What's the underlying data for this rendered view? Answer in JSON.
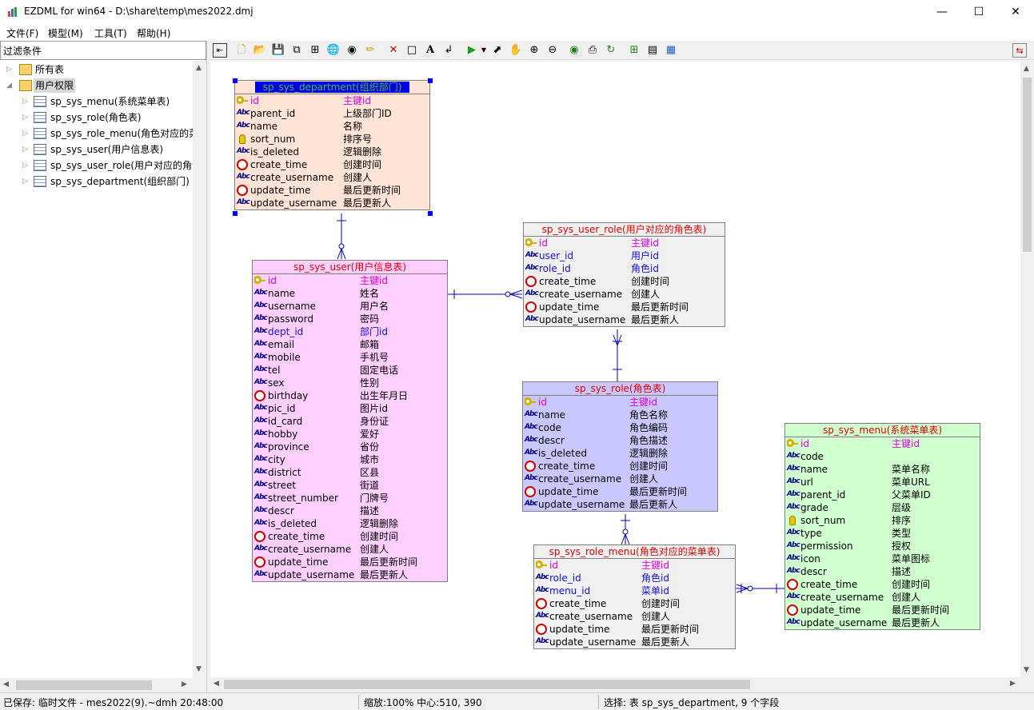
{
  "window": {
    "title": "EZDML for win64 - D:\\share\\temp\\mes2022.dmj"
  },
  "menu": [
    "文件(F)",
    "模型(M)",
    "工具(T)",
    "帮助(H)"
  ],
  "filter": {
    "label": "过滤条件"
  },
  "tree": {
    "root_all": "所有表",
    "group": "用户权限",
    "items": [
      "sp_sys_menu(系统菜单表)",
      "sp_sys_role(角色表)",
      "sp_sys_role_menu(角色对应的菜",
      "sp_sys_user(用户信息表)",
      "sp_sys_user_role(用户对应的角色",
      "sp_sys_department(组织部门)"
    ]
  },
  "entities": {
    "department": {
      "title": "sp_sys_department(组织部门)",
      "bg": "#fde4d6",
      "fields": [
        {
          "n": "id",
          "c": "主键id",
          "i": "key",
          "k": "pk"
        },
        {
          "n": "parent_id",
          "c": "上级部门ID",
          "i": "abc",
          "k": ""
        },
        {
          "n": "name",
          "c": "名称",
          "i": "abc",
          "k": ""
        },
        {
          "n": "sort_num",
          "c": "排序号",
          "i": "bulb",
          "k": ""
        },
        {
          "n": "is_deleted",
          "c": "逻辑删除",
          "i": "abc",
          "k": ""
        },
        {
          "n": "create_time",
          "c": "创建时间",
          "i": "clock",
          "k": ""
        },
        {
          "n": "create_username",
          "c": "创建人",
          "i": "abc",
          "k": ""
        },
        {
          "n": "update_time",
          "c": "最后更新时间",
          "i": "clock",
          "k": ""
        },
        {
          "n": "update_username",
          "c": "最后更新人",
          "i": "abc",
          "k": ""
        }
      ]
    },
    "user": {
      "title": "sp_sys_user(用户信息表)",
      "bg": "#ffd0ff",
      "fields": [
        {
          "n": "id",
          "c": "主键id",
          "i": "key",
          "k": "pk"
        },
        {
          "n": "name",
          "c": "姓名",
          "i": "abc",
          "k": ""
        },
        {
          "n": "username",
          "c": "用户名",
          "i": "abc",
          "k": ""
        },
        {
          "n": "password",
          "c": "密码",
          "i": "abc",
          "k": ""
        },
        {
          "n": "dept_id",
          "c": "部门id",
          "i": "abc",
          "k": "fk"
        },
        {
          "n": "email",
          "c": "邮箱",
          "i": "abc",
          "k": ""
        },
        {
          "n": "mobile",
          "c": "手机号",
          "i": "abc",
          "k": ""
        },
        {
          "n": "tel",
          "c": "固定电话",
          "i": "abc",
          "k": ""
        },
        {
          "n": "sex",
          "c": "性别",
          "i": "abc",
          "k": ""
        },
        {
          "n": "birthday",
          "c": "出生年月日",
          "i": "clock",
          "k": ""
        },
        {
          "n": "pic_id",
          "c": "图片id",
          "i": "abc",
          "k": ""
        },
        {
          "n": "id_card",
          "c": "身份证",
          "i": "abc",
          "k": ""
        },
        {
          "n": "hobby",
          "c": "爱好",
          "i": "abc",
          "k": ""
        },
        {
          "n": "province",
          "c": "省份",
          "i": "abc",
          "k": ""
        },
        {
          "n": "city",
          "c": "城市",
          "i": "abc",
          "k": ""
        },
        {
          "n": "district",
          "c": "区县",
          "i": "abc",
          "k": ""
        },
        {
          "n": "street",
          "c": "街道",
          "i": "abc",
          "k": ""
        },
        {
          "n": "street_number",
          "c": "门牌号",
          "i": "abc",
          "k": ""
        },
        {
          "n": "descr",
          "c": "描述",
          "i": "abc",
          "k": ""
        },
        {
          "n": "is_deleted",
          "c": "逻辑删除",
          "i": "abc",
          "k": ""
        },
        {
          "n": "create_time",
          "c": "创建时间",
          "i": "clock",
          "k": ""
        },
        {
          "n": "create_username",
          "c": "创建人",
          "i": "abc",
          "k": ""
        },
        {
          "n": "update_time",
          "c": "最后更新时间",
          "i": "clock",
          "k": ""
        },
        {
          "n": "update_username",
          "c": "最后更新人",
          "i": "abc",
          "k": ""
        }
      ]
    },
    "user_role": {
      "title": "sp_sys_user_role(用户对应的角色表)",
      "bg": "#f0f0f0",
      "fields": [
        {
          "n": "id",
          "c": "主键id",
          "i": "key",
          "k": "pk"
        },
        {
          "n": "user_id",
          "c": "用户id",
          "i": "abc",
          "k": "fk"
        },
        {
          "n": "role_id",
          "c": "角色id",
          "i": "abc",
          "k": "fk"
        },
        {
          "n": "create_time",
          "c": "创建时间",
          "i": "clock",
          "k": ""
        },
        {
          "n": "create_username",
          "c": "创建人",
          "i": "abc",
          "k": ""
        },
        {
          "n": "update_time",
          "c": "最后更新时间",
          "i": "clock",
          "k": ""
        },
        {
          "n": "update_username",
          "c": "最后更新人",
          "i": "abc",
          "k": ""
        }
      ]
    },
    "role": {
      "title": "sp_sys_role(角色表)",
      "bg": "#c8c8ff",
      "fields": [
        {
          "n": "id",
          "c": "主键id",
          "i": "key",
          "k": "pk"
        },
        {
          "n": "name",
          "c": "角色名称",
          "i": "abc",
          "k": ""
        },
        {
          "n": "code",
          "c": "角色编码",
          "i": "abc",
          "k": ""
        },
        {
          "n": "descr",
          "c": "角色描述",
          "i": "abc",
          "k": ""
        },
        {
          "n": "is_deleted",
          "c": "逻辑删除",
          "i": "abc",
          "k": ""
        },
        {
          "n": "create_time",
          "c": "创建时间",
          "i": "clock",
          "k": ""
        },
        {
          "n": "create_username",
          "c": "创建人",
          "i": "abc",
          "k": ""
        },
        {
          "n": "update_time",
          "c": "最后更新时间",
          "i": "clock",
          "k": ""
        },
        {
          "n": "update_username",
          "c": "最后更新人",
          "i": "abc",
          "k": ""
        }
      ]
    },
    "role_menu": {
      "title": "sp_sys_role_menu(角色对应的菜单表)",
      "bg": "#f0f0f0",
      "fields": [
        {
          "n": "id",
          "c": "主键id",
          "i": "key",
          "k": "pk"
        },
        {
          "n": "role_id",
          "c": "角色id",
          "i": "abc",
          "k": "fk"
        },
        {
          "n": "menu_id",
          "c": "菜单id",
          "i": "abc",
          "k": "fk"
        },
        {
          "n": "create_time",
          "c": "创建时间",
          "i": "clock",
          "k": ""
        },
        {
          "n": "create_username",
          "c": "创建人",
          "i": "abc",
          "k": ""
        },
        {
          "n": "update_time",
          "c": "最后更新时间",
          "i": "clock",
          "k": ""
        },
        {
          "n": "update_username",
          "c": "最后更新人",
          "i": "abc",
          "k": ""
        }
      ]
    },
    "menu": {
      "title": "sp_sys_menu(系统菜单表)",
      "bg": "#d0ffd0",
      "fields": [
        {
          "n": "id",
          "c": "主键id",
          "i": "key",
          "k": "pk"
        },
        {
          "n": "code",
          "c": "",
          "i": "abc",
          "k": ""
        },
        {
          "n": "name",
          "c": "菜单名称",
          "i": "abc",
          "k": ""
        },
        {
          "n": "url",
          "c": "菜单URL",
          "i": "abc",
          "k": ""
        },
        {
          "n": "parent_id",
          "c": "父菜单ID",
          "i": "abc",
          "k": ""
        },
        {
          "n": "grade",
          "c": "层级",
          "i": "abc",
          "k": ""
        },
        {
          "n": "sort_num",
          "c": "排序",
          "i": "bulb",
          "k": ""
        },
        {
          "n": "type",
          "c": "类型",
          "i": "abc",
          "k": ""
        },
        {
          "n": "permission",
          "c": "授权",
          "i": "abc",
          "k": ""
        },
        {
          "n": "icon",
          "c": "菜单图标",
          "i": "abc",
          "k": ""
        },
        {
          "n": "descr",
          "c": "描述",
          "i": "abc",
          "k": ""
        },
        {
          "n": "create_time",
          "c": "创建时间",
          "i": "clock",
          "k": ""
        },
        {
          "n": "create_username",
          "c": "创建人",
          "i": "abc",
          "k": ""
        },
        {
          "n": "update_time",
          "c": "最后更新时间",
          "i": "clock",
          "k": ""
        },
        {
          "n": "update_username",
          "c": "最后更新人",
          "i": "abc",
          "k": ""
        }
      ]
    }
  },
  "status": {
    "saved": "已保存: 临时文件 - mes2022(9).~dmh 20:48:00",
    "zoom": "缩放:100% 中心:510, 390",
    "selection": "选择: 表 sp_sys_department, 9 个字段"
  }
}
